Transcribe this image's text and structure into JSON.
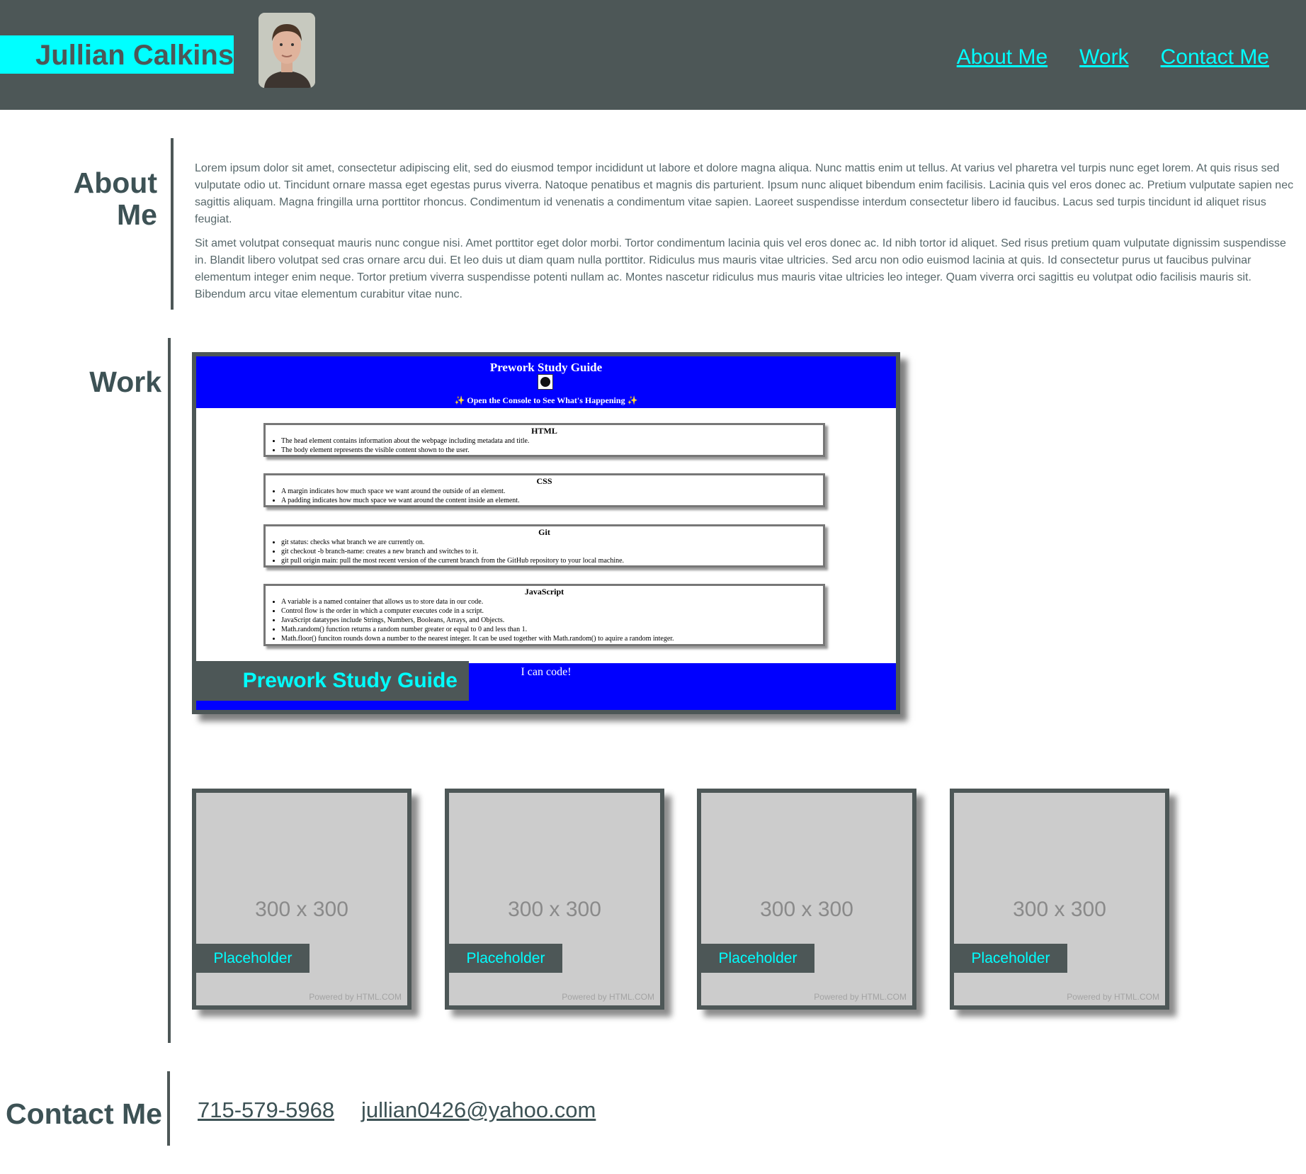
{
  "header": {
    "name": "Jullian Calkins",
    "nav": [
      "About Me",
      "Work",
      "Contact Me"
    ]
  },
  "about": {
    "title": "About Me",
    "paragraphs": [
      "Lorem ipsum dolor sit amet, consectetur adipiscing elit, sed do eiusmod tempor incididunt ut labore et dolore magna aliqua. Nunc mattis enim ut tellus. At varius vel pharetra vel turpis nunc eget lorem. At quis risus sed vulputate odio ut. Tincidunt ornare massa eget egestas purus viverra. Natoque penatibus et magnis dis parturient. Ipsum nunc aliquet bibendum enim facilisis. Lacinia quis vel eros donec ac. Pretium vulputate sapien nec sagittis aliquam. Magna fringilla urna porttitor rhoncus. Condimentum id venenatis a condimentum vitae sapien. Laoreet suspendisse interdum consectetur libero id faucibus. Lacus sed turpis tincidunt id aliquet risus feugiat.",
      "Sit amet volutpat consequat mauris nunc congue nisi. Amet porttitor eget dolor morbi. Tortor condimentum lacinia quis vel eros donec ac. Id nibh tortor id aliquet. Sed risus pretium quam vulputate dignissim suspendisse in. Blandit libero volutpat sed cras ornare arcu dui. Et leo duis ut diam quam nulla porttitor. Ridiculus mus mauris vitae ultricies. Sed arcu non odio euismod lacinia at quis. Id consectetur purus ut faucibus pulvinar elementum integer enim neque. Tortor pretium viverra suspendisse potenti nullam ac. Montes nascetur ridiculus mus mauris vitae ultricies leo integer. Quam viverra orci sagittis eu volutpat odio facilisis mauris sit. Bibendum arcu vitae elementum curabitur vitae nunc."
    ]
  },
  "work": {
    "title": "Work",
    "featured": {
      "label": "Prework Study Guide",
      "preview": {
        "title": "Prework Study Guide",
        "subtitle": "✨ Open the Console to See What's Happening ✨",
        "cards": [
          {
            "heading": "HTML",
            "items": [
              "The head element contains information about the webpage including metadata and title.",
              "The body element represents the visible content shown to the user."
            ]
          },
          {
            "heading": "CSS",
            "items": [
              "A margin indicates how much space we want around the outside of an element.",
              "A padding indicates how much space we want around the content inside an element."
            ]
          },
          {
            "heading": "Git",
            "items": [
              "git status: checks what branch we are currently on.",
              "git checkout -b branch-name: creates a new branch and switches to it.",
              "git pull origin main: pull the most recent version of the current branch from the GitHub repository to your local machine."
            ]
          },
          {
            "heading": "JavaScript",
            "items": [
              "A variable is a named container that allows us to store data in our code.",
              "Control flow is the order in which a computer executes code in a script.",
              "JavaScript datatypes include Strings, Numbers, Booleans, Arrays, and Objects.",
              "Math.random() function returns a random number greater or equal to 0 and less than 1.",
              "Math.floor() funciton rounds down a number to the nearest integer. It can be used together with Math.random() to aquire a random integer."
            ]
          }
        ],
        "footer": "I can code!"
      }
    },
    "placeholders": [
      {
        "size": "300 x 300",
        "label": "Placeholder",
        "powered": "Powered by HTML.COM"
      },
      {
        "size": "300 x 300",
        "label": "Placeholder",
        "powered": "Powered by HTML.COM"
      },
      {
        "size": "300 x 300",
        "label": "Placeholder",
        "powered": "Powered by HTML.COM"
      },
      {
        "size": "300 x 300",
        "label": "Placeholder",
        "powered": "Powered by HTML.COM"
      }
    ]
  },
  "contact": {
    "title": "Contact Me",
    "phone": "715-579-5968",
    "email": "jullian0426@yahoo.com"
  }
}
